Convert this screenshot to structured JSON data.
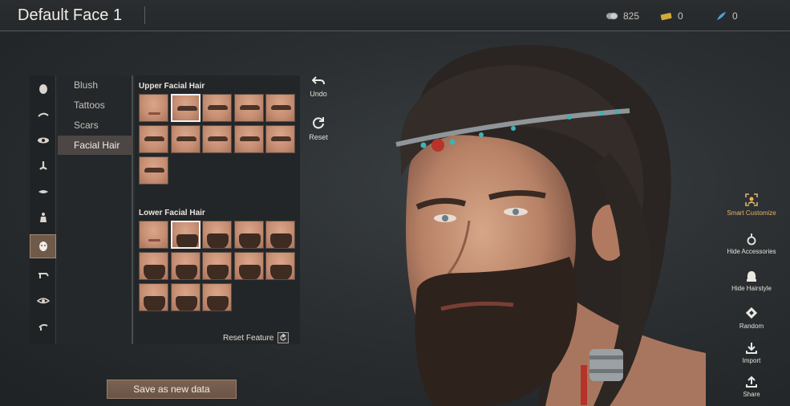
{
  "header": {
    "title": "Default Face 1",
    "currencies": [
      {
        "icon": "silver-coin-icon",
        "value": "825"
      },
      {
        "icon": "gold-ticket-icon",
        "value": "0"
      },
      {
        "icon": "blue-feather-icon",
        "value": "0"
      }
    ]
  },
  "categories": [
    {
      "icon": "head-icon"
    },
    {
      "icon": "eyebrow-icon"
    },
    {
      "icon": "eye-icon"
    },
    {
      "icon": "nose-icon"
    },
    {
      "icon": "mouth-icon"
    },
    {
      "icon": "body-icon"
    },
    {
      "icon": "face-detail-icon",
      "active": true
    },
    {
      "icon": "jaw-icon"
    },
    {
      "icon": "eye-shape-icon"
    },
    {
      "icon": "ear-icon"
    }
  ],
  "subcategories": [
    {
      "label": "Blush"
    },
    {
      "label": "Tattoos"
    },
    {
      "label": "Scars"
    },
    {
      "label": "Facial Hair",
      "active": true
    }
  ],
  "upper_section": {
    "label": "Upper Facial Hair",
    "count": 11,
    "selected_index": 1
  },
  "lower_section": {
    "label": "Lower Facial Hair",
    "count": 13,
    "selected_index": 1
  },
  "reset_feature_label": "Reset Feature",
  "tools": {
    "undo": "Undo",
    "reset": "Reset"
  },
  "save_label": "Save as new data",
  "side_tools": [
    {
      "label": "Smart Customize",
      "icon": "smart-customize-icon"
    },
    {
      "label": "Hide Accessories",
      "icon": "hide-accessories-icon"
    },
    {
      "label": "Hide Hairstyle",
      "icon": "hide-hairstyle-icon"
    },
    {
      "label": "Random",
      "icon": "random-icon"
    },
    {
      "label": "Import",
      "icon": "import-icon"
    },
    {
      "label": "Share",
      "icon": "share-icon"
    }
  ],
  "colors": {
    "accent": "#6f5a49",
    "smart_customize": "#e3b564",
    "swatch_skin": "#c78f73"
  }
}
